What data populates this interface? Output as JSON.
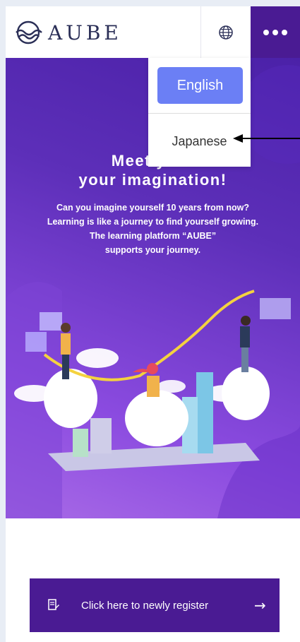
{
  "header": {
    "brand": "AUBE",
    "logo_icon": "wave-circle-logo",
    "language_icon": "globe-icon",
    "menu_icon": "more-dots-icon"
  },
  "language_menu": {
    "options": [
      "English",
      "Japanese"
    ],
    "selected": "English"
  },
  "hero": {
    "title_line1": "Meet your",
    "title_line2": "your imagination!",
    "subtitle": [
      "Can you imagine yourself 10 years from now?",
      "Learning is like a journey to find yourself growing.",
      "The learning platform “AUBE”",
      "supports your journey."
    ]
  },
  "register": {
    "label": "Click here to newly register",
    "arrow": "→",
    "icon": "edit-note-icon"
  },
  "colors": {
    "brand_purple": "#4a1b93",
    "option_blue": "#6b7ff5",
    "hero_gradient_top": "#4b21a8",
    "hero_gradient_bottom": "#a86ae6"
  }
}
